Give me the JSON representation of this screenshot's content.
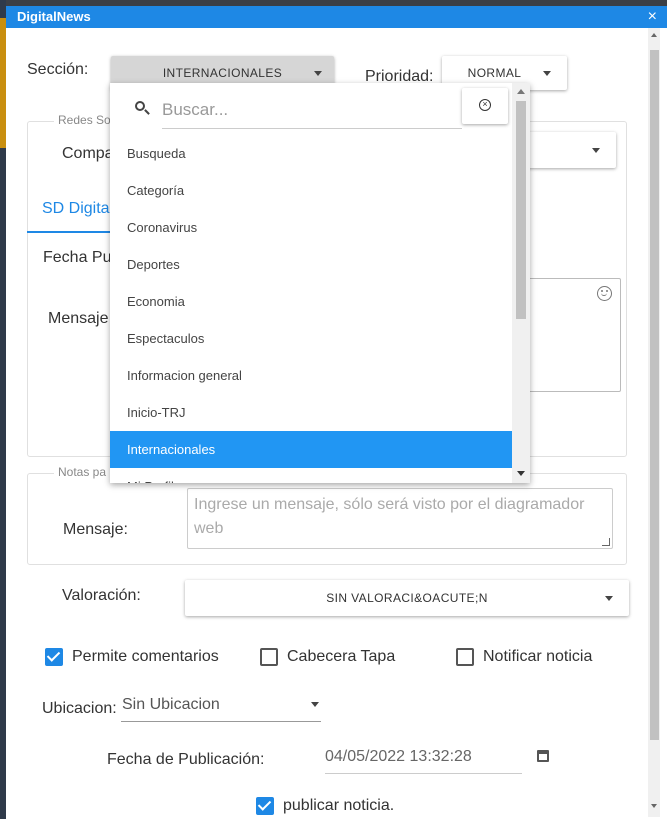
{
  "window": {
    "title": "DigitalNews",
    "close_icon": "×"
  },
  "seccion": {
    "label": "Sección:",
    "value": "INTERNACIONALES"
  },
  "prioridad": {
    "label": "Prioridad:",
    "value": "NORMAL"
  },
  "redes": {
    "legend": "Redes So",
    "compartir_label": "Compa",
    "tab_label": "SD Digital",
    "fecha_label": "Fecha Pu",
    "mensaje_label": "Mensaje"
  },
  "dropdown": {
    "search_placeholder": "Buscar...",
    "items": [
      "Busqueda",
      "Categoría",
      "Coronavirus",
      "Deportes",
      "Economia",
      "Espectaculos",
      "Informacion general",
      "Inicio-TRJ",
      "Internacionales",
      "Mi Perfil"
    ],
    "selected_index": 8
  },
  "notas": {
    "legend": "Notas pa",
    "mensaje_label": "Mensaje:",
    "placeholder": "Ingrese un mensaje, sólo será visto por el diagramador web"
  },
  "valoracion": {
    "label": "Valoración:",
    "value": "SIN VALORACI&OACUTE;N"
  },
  "checkboxes": [
    {
      "label": "Permite comentarios",
      "checked": true
    },
    {
      "label": "Cabecera Tapa",
      "checked": false
    },
    {
      "label": "Notificar noticia",
      "checked": false
    }
  ],
  "ubicacion": {
    "label": "Ubicacion:",
    "value": "Sin Ubicacion"
  },
  "fecha_publicacion": {
    "label": "Fecha de Publicación:",
    "value": "04/05/2022 13:32:28"
  },
  "publicar": {
    "label": "publicar noticia.",
    "checked": true
  },
  "colors": {
    "accent": "#1e88e5",
    "selected": "#2196f3"
  }
}
